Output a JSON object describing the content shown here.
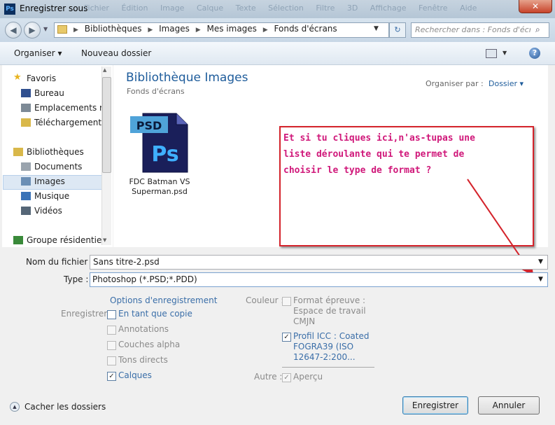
{
  "window": {
    "title": "Enregistrer sous",
    "app_icon": "Ps",
    "ghost_menu": "Fichier Édition Image Calque Texte Sélection Filtre 3D Affichage Fenêtre Aide",
    "close_glyph": "✕"
  },
  "address": {
    "crumbs": [
      "Bibliothèques",
      "Images",
      "Mes images",
      "Fonds d'écrans"
    ],
    "search_placeholder": "Rechercher dans : Fonds d'écr...",
    "icons": [
      "back-arrow-icon",
      "forward-arrow-icon",
      "folder-icon",
      "refresh-icon",
      "search-icon"
    ]
  },
  "toolbar": {
    "organize": "Organiser ▾",
    "new_folder": "Nouveau dossier",
    "help": "?"
  },
  "sidebar": {
    "items": [
      {
        "label": "Favoris",
        "icon": "star-icon",
        "color": "#e8b420"
      },
      {
        "label": "Bureau",
        "icon": "desktop-icon",
        "color": "#2f4f8f"
      },
      {
        "label": "Emplacements ré",
        "icon": "recent-places-icon",
        "color": "#7d8a96"
      },
      {
        "label": "Téléchargements",
        "icon": "downloads-folder-icon",
        "color": "#d9b84a"
      },
      {
        "label": "Bibliothèques",
        "icon": "libraries-icon",
        "color": "#d9b84a"
      },
      {
        "label": "Documents",
        "icon": "documents-icon",
        "color": "#9aa4ae"
      },
      {
        "label": "Images",
        "icon": "pictures-icon",
        "color": "#6b8fb5"
      },
      {
        "label": "Musique",
        "icon": "music-icon",
        "color": "#3a73b7"
      },
      {
        "label": "Vidéos",
        "icon": "videos-icon",
        "color": "#556677"
      },
      {
        "label": "Groupe résidentiel",
        "icon": "homegroup-icon",
        "color": "#3a8a3a"
      }
    ],
    "selected": "Images"
  },
  "main": {
    "title": "Bibliothèque Images",
    "subtitle": "Fonds d'écrans",
    "arrange_label": "Organiser par :",
    "arrange_value": "Dossier ▾",
    "file": {
      "icon_badge": "PSD",
      "icon_logo": "Ps",
      "name_line1": "FDC Batman VS",
      "name_line2": "Superman.psd"
    }
  },
  "annotation": {
    "line1": "Et si tu cliques ici,n'as-tupas une",
    "line2": "liste déroulante qui te permet de",
    "line3": "choisir le type de format ?",
    "color": "#d0187a",
    "border_color": "#d4232b"
  },
  "form": {
    "filename_label": "Nom du fichier :",
    "filename_value": "Sans titre-2.psd",
    "type_label": "Type :",
    "type_value": "Photoshop (*.PSD;*.PDD)",
    "options_link": "Options d'enregistrement",
    "save_label": "Enregistrer :",
    "save_options": [
      {
        "label": "En tant que copie",
        "checked": false,
        "enabled": true
      },
      {
        "label": "Annotations",
        "checked": false,
        "enabled": false
      },
      {
        "label": "Couches alpha",
        "checked": false,
        "enabled": false
      },
      {
        "label": "Tons directs",
        "checked": false,
        "enabled": false
      },
      {
        "label": "Calques",
        "checked": true,
        "enabled": true
      }
    ],
    "color_label": "Couleur :",
    "proof_format": [
      "Format épreuve :",
      "Espace de travail",
      "CMJN"
    ],
    "icc_profile": [
      "Profil ICC : Coated",
      "FOGRA39 (ISO",
      "12647-2:200..."
    ],
    "other_label": "Autre :",
    "preview_label": "Aperçu"
  },
  "footer": {
    "hide_folders": "Cacher les dossiers",
    "save_button": "Enregistrer",
    "cancel_button": "Annuler"
  }
}
